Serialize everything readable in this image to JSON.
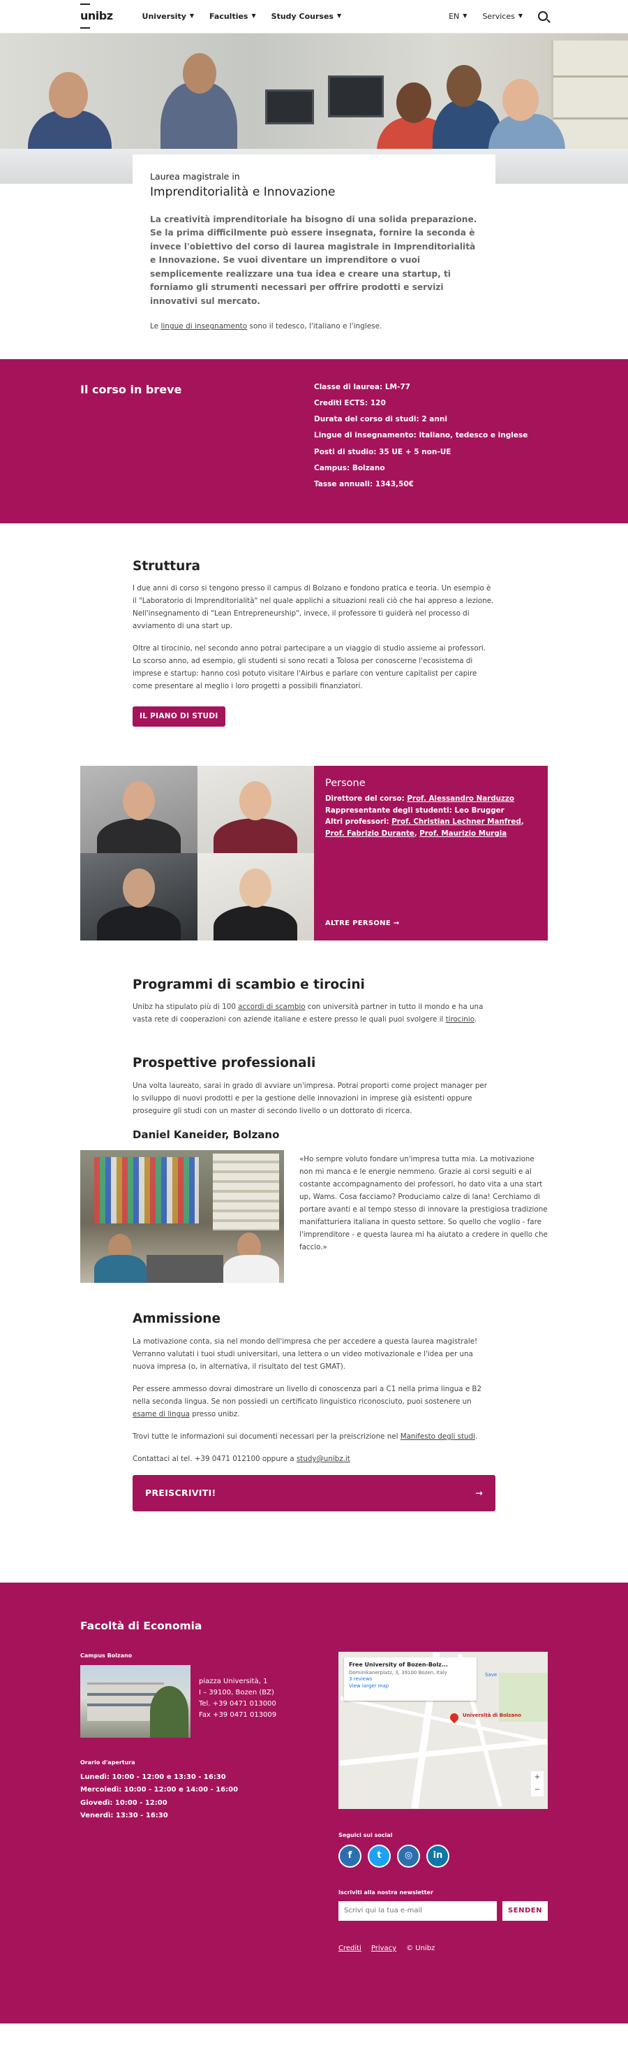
{
  "header": {
    "logo": "unibz",
    "nav": [
      "University",
      "Faculties",
      "Study Courses"
    ],
    "lang": "EN",
    "services": "Services"
  },
  "intro": {
    "subtitle": "Laurea magistrale in",
    "title": "Imprenditorialità e Innovazione",
    "lead": "La creatività imprenditoriale ha bisogno di una solida preparazione. Se la prima difficilmente può essere insegnata, fornire la seconda è invece l'obiettivo del corso di laurea magistrale in Imprenditorialità e Innovazione. Se vuoi diventare un imprenditore o vuoi semplicemente realizzare una tua idea e creare una startup, ti forniamo gli strumenti necessari per offrire prodotti e servizi innovativi sul mercato.",
    "lang_pre": "Le ",
    "lang_link": "lingue di insegnamento",
    "lang_post": " sono il tedesco, l'italiano e l'inglese."
  },
  "brief": {
    "title": "Il corso in breve",
    "items": [
      "Classe di laurea: LM-77",
      "Crediti ECTS: 120",
      "Durata del corso di studi: 2 anni",
      "Lingue di insegnamento: italiano, tedesco e inglese",
      "Posti di studio: 35 UE + 5 non-UE",
      "Campus: Bolzano",
      "Tasse annuali: 1343,50€"
    ]
  },
  "structure": {
    "title": "Struttura",
    "p1": "I due anni di corso si tengono presso il campus di Bolzano e fondono pratica e teoria. Un esempio è il \"Laboratorio di Imprenditorialità\" nel quale applichi a situazioni reali ciò che hai appreso a lezione. Nell'insegnamento di \"Lean Entrepreneurship\", invece, il professore ti guiderà nel processo di avviamento di una start up.",
    "p2": "Oltre al tirocinio, nel secondo anno potrai partecipare a un viaggio di studio assieme ai professori. Lo scorso anno, ad esempio, gli studenti si sono recati a Tolosa per conoscerne l'ecosistema di imprese e startup: hanno così potuto visitare l'Airbus e parlare con venture capitalist per capire come presentare al meglio i loro progetti a possibili finanziatori.",
    "button": "IL PIANO DI STUDI"
  },
  "people": {
    "title": "Persone",
    "director_label": "Direttore del corso: ",
    "director": "Prof. Alessandro Narduzzo",
    "rep": "Rappresentante degli studenti: Leo Brugger",
    "others_label": "Altri professori: ",
    "others": [
      "Prof. Christian Lechner Manfred",
      "Prof. Fabrizio Durante",
      "Prof. Maurizio Murgia"
    ],
    "more": "ALTRE PERSONE →"
  },
  "exchange": {
    "title": "Programmi di scambio e tirocini",
    "pre": "Unibz ha stipulato più di 100 ",
    "link1": "accordi di scambio",
    "mid": " con università partner in tutto il mondo e ha una vasta rete di cooperazioni con aziende italiane e estere presso le quali puoi svolgere il ",
    "link2": "tirocinio",
    "post": "."
  },
  "prospects": {
    "title": "Prospettive professionali",
    "text": "Una volta laureato, sarai in grado di avviare un'impresa. Potrai proporti come project manager per lo sviluppo di nuovi prodotti e per la gestione delle innovazioni in imprese già esistenti oppure proseguire gli studi con un master di secondo livello o un dottorato di ricerca."
  },
  "testimonial": {
    "name": "Daniel Kaneider, Bolzano",
    "quote": "«Ho sempre voluto fondare un'impresa tutta mia. La motivazione non mi manca e le energie nemmeno. Grazie ai corsi seguiti e al costante accompagnamento dei professori, ho dato vita a una start up, Wams. Cosa facciamo? Produciamo calze di lana! Cerchiamo di portare avanti e al tempo stesso di innovare la prestigiosa tradizione manifatturiera italiana in questo settore. So quello che voglio - fare l'imprenditore - e questa laurea mi ha aiutato a credere in quello che faccio.»"
  },
  "admission": {
    "title": "Ammissione",
    "p1": "La motivazione conta, sia nel mondo dell'impresa che per accedere a questa laurea magistrale! Verranno valutati i tuoi studi universitari, una lettera o un video motivazionale e l'idea per una nuova impresa (o, in alternativa, il risultato del test GMAT).",
    "p2_pre": "Per essere ammesso dovrai dimostrare un livello di conoscenza pari a C1 nella prima lingua e B2 nella seconda lingua. Se non possiedi un certificato linguistico riconosciuto, puoi sostenere un ",
    "p2_link": "esame di lingua",
    "p2_post": " presso unibz.",
    "p3_pre": "Trovi tutte le informazioni sui documenti necessari per la preiscrizione nel ",
    "p3_link": "Manifesto degli studi",
    "p3_post": ".",
    "p4_pre": "Contattaci al tel. +39 0471 012100 oppure a ",
    "p4_link": "study@unibz.it",
    "button": "PREISCRIVITI!"
  },
  "footer": {
    "title": "Facoltà di Economia",
    "campus_label": "Campus Bolzano",
    "address": [
      "piazza Università, 1",
      "I – 39100, Bozen (BZ)",
      "Tel. +39 0471 013000",
      "Fax +39 0471 013009"
    ],
    "hours_label": "Orario d'apertura",
    "hours": [
      "Lunedì: 10:00 - 12:00 e 13:30 - 16:30",
      "Mercoledì: 10:00 - 12:00 e 14:00 - 16:00",
      "Giovedì: 10:00 - 12:00",
      "Venerdì: 13:30 - 16:30"
    ],
    "map": {
      "name": "Free University of Bozen-Bolz...",
      "address": "Dominikanerplatz, 3, 39100 Bozen, Italy",
      "reviews": "3 reviews",
      "larger": "View larger map",
      "save": "Save",
      "pin_label": "Università di Bolzano"
    },
    "social_label": "Seguici sui social",
    "social": [
      "f",
      "t",
      "◎",
      "in"
    ],
    "newsletter_label": "Iscriviti alla nostra newsletter",
    "newsletter_placeholder": "Scrivi qui la tua e-mail",
    "newsletter_button": "SENDEN",
    "links": [
      "Crediti",
      "Privacy",
      "© Unibz"
    ]
  },
  "colors": {
    "accent": "#a5145a"
  }
}
